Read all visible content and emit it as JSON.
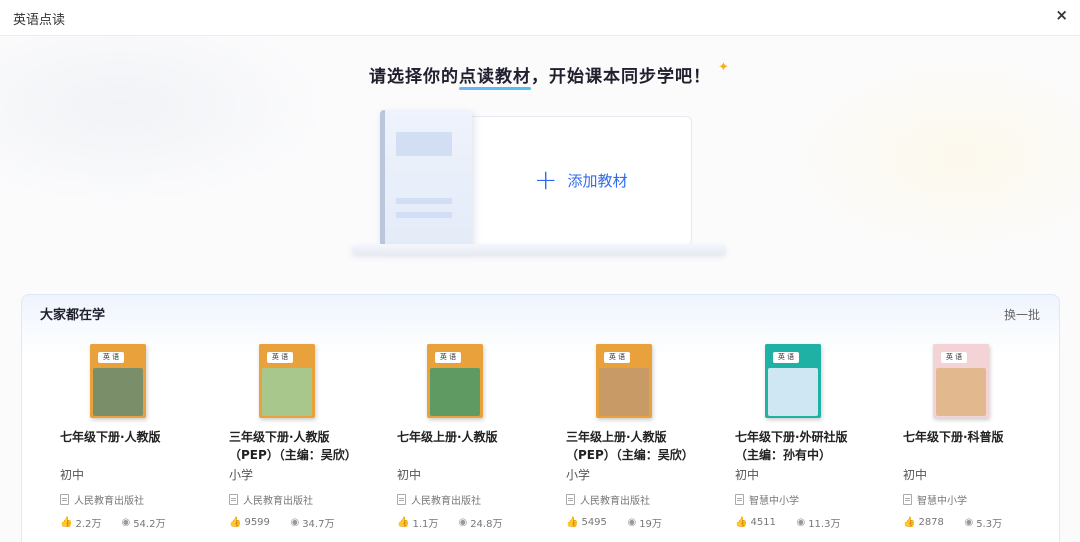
{
  "window": {
    "title": "英语点读",
    "close_icon": "×"
  },
  "hero": {
    "headline_pre": "请选择你的",
    "headline_highlight": "点读教材",
    "headline_post": "，开始课本同步学吧！",
    "add_button_label": "添加教材"
  },
  "popular": {
    "title": "大家都在学",
    "refresh_label": "换一批",
    "books": [
      {
        "name": "七年级下册·人教版",
        "level": "初中",
        "publisher": "人民教育出版社",
        "likes": "2.2万",
        "views": "54.2万",
        "cover_color": "#e9a23b",
        "image_color": "#7a8e6a"
      },
      {
        "name": "三年级下册·人教版（PEP）（主编：吴欣）",
        "level": "小学",
        "publisher": "人民教育出版社",
        "likes": "9599",
        "views": "34.7万",
        "cover_color": "#e9a23b",
        "image_color": "#a7c78d"
      },
      {
        "name": "七年级上册·人教版",
        "level": "初中",
        "publisher": "人民教育出版社",
        "likes": "1.1万",
        "views": "24.8万",
        "cover_color": "#e9a23b",
        "image_color": "#5f9a63"
      },
      {
        "name": "三年级上册·人教版（PEP）（主编：吴欣）",
        "level": "小学",
        "publisher": "人民教育出版社",
        "likes": "5495",
        "views": "19万",
        "cover_color": "#e9a23b",
        "image_color": "#c79a66"
      },
      {
        "name": "七年级下册·外研社版（主编：孙有中）",
        "level": "初中",
        "publisher": "智慧中小学",
        "likes": "4511",
        "views": "11.3万",
        "cover_color": "#1fb1a4",
        "image_color": "#cfe7f2"
      },
      {
        "name": "七年级下册·科普版",
        "level": "初中",
        "publisher": "智慧中小学",
        "likes": "2878",
        "views": "5.3万",
        "cover_color": "#f4d3d6",
        "image_color": "#e2b98e"
      }
    ]
  }
}
